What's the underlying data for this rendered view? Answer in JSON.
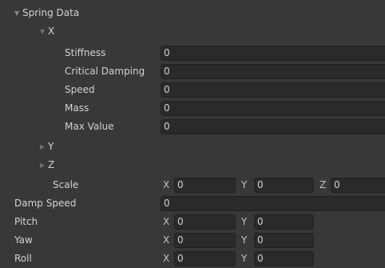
{
  "spring_data": {
    "label": "Spring Data",
    "x_foldout": {
      "label": "X",
      "fields": [
        {
          "label": "Stiffness",
          "value": "0"
        },
        {
          "label": "Critical Damping",
          "value": "0"
        },
        {
          "label": "Speed",
          "value": "0"
        },
        {
          "label": "Mass",
          "value": "0"
        },
        {
          "label": "Max Value",
          "value": "0"
        }
      ]
    },
    "y_foldout": {
      "label": "Y"
    },
    "z_foldout": {
      "label": "Z"
    },
    "scale": {
      "label": "Scale",
      "x_label": "X",
      "x_value": "0",
      "y_label": "Y",
      "y_value": "0",
      "z_label": "Z",
      "z_value": "0"
    }
  },
  "damp_speed": {
    "label": "Damp Speed",
    "value": "0"
  },
  "pitch": {
    "label": "Pitch",
    "x_label": "X",
    "x_value": "0",
    "y_label": "Y",
    "y_value": "0"
  },
  "yaw": {
    "label": "Yaw",
    "x_label": "X",
    "x_value": "0",
    "y_label": "Y",
    "y_value": "0"
  },
  "roll": {
    "label": "Roll",
    "x_label": "X",
    "x_value": "0",
    "y_label": "Y",
    "y_value": "0"
  }
}
